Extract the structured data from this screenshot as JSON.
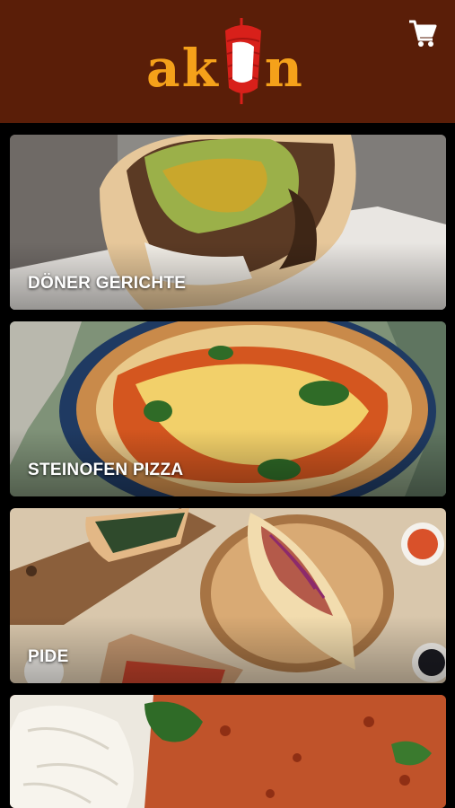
{
  "app": {
    "logo_text": "ak n",
    "logo_brand": "akin"
  },
  "header": {
    "cart_icon": "shopping-cart-icon"
  },
  "categories": [
    {
      "label": "DÖNER GERICHTE"
    },
    {
      "label": "STEINOFEN PIZZA"
    },
    {
      "label": "PIDE"
    },
    {
      "label": ""
    }
  ],
  "colors": {
    "header_bg": "#5a1e08",
    "logo_orange": "#f5a11a",
    "logo_red": "#d8201a"
  }
}
